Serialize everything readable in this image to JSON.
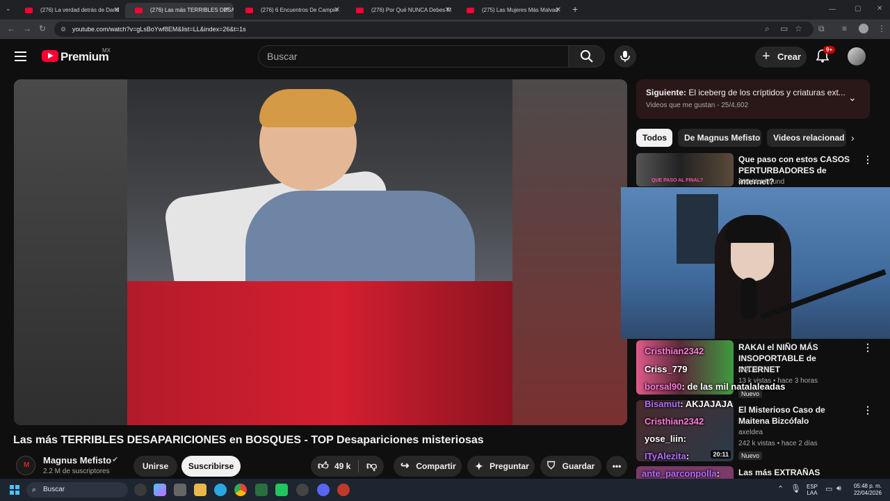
{
  "browser": {
    "tabs": [
      {
        "label": "(276) La verdad detrás de Dand"
      },
      {
        "label": "(276) Las más TERRIBLES DESAP"
      },
      {
        "label": "(276) 6 Encuentros De Campin"
      },
      {
        "label": "(276) Por Qué NUNCA Debes M"
      },
      {
        "label": "(275) Las Mujeres Más Malvad"
      }
    ],
    "new_tab": "+",
    "url": "youtube.com/watch?v=gLsBoYwf8EM&list=LL&index=26&t=1s"
  },
  "header": {
    "logo_text": "Premium",
    "logo_region": "MX",
    "search_placeholder": "Buscar",
    "create_label": "Crear",
    "notif_badge": "9+"
  },
  "video": {
    "title": "Las más TERRIBLES DESAPARICIONES en BOSQUES - TOP Desapariciones misteriosas",
    "channel": "Magnus Mefisto",
    "subscribers": "2.2 M de suscriptores",
    "join_label": "Unirse",
    "subscribe_label": "Suscribirse",
    "likes": "49 k",
    "share_label": "Compartir",
    "ask_label": "Preguntar",
    "save_label": "Guardar"
  },
  "queue": {
    "next_prefix": "Siguiente:",
    "next_title": "El iceberg de los críptidos y criaturas ext...",
    "playlist": "Videos que me gustan",
    "position": "25/4,602"
  },
  "chips": [
    "Todos",
    "De Magnus Mefisto",
    "Videos relacionad"
  ],
  "recommendations": [
    {
      "title": "Que paso con estos CASOS PERTURBADORES de internet?",
      "channel": "404 Not Found",
      "thumb_text": "QUE PASO AL FINAL?"
    },
    {
      "title": "RAKAI el NIÑO MÁS INSOPORTABLE de INTERNET",
      "channel": "AQUISI R",
      "meta": "13 k vistas • hace 3 horas",
      "badge": "Nuevo"
    },
    {
      "title": "El Misterioso Caso de Maitena Bizcófalo",
      "channel": "axeldea",
      "meta": "242 k vistas • hace 2 días",
      "badge": "Nuevo",
      "duration": "20:11"
    },
    {
      "title": "Las más EXTRAÑAS"
    }
  ],
  "overlay_chat": [
    {
      "user": "Cristhian2342",
      "msg": ""
    },
    {
      "user": "Criss_779",
      "msg": ""
    },
    {
      "user": "borsal90",
      "msg": ": de las mil natalaleadas"
    },
    {
      "user": "Bisamut",
      "msg": ": AKJAJAJA"
    },
    {
      "user": "Cristhian2342",
      "msg": ""
    },
    {
      "user": "yose_liin",
      "msg": ":"
    },
    {
      "user": "ITyAlezita",
      "msg": ":"
    },
    {
      "user": "ante_parconpolla",
      "msg": ":"
    }
  ],
  "taskbar": {
    "search_label": "Buscar",
    "lang_top": "ESP",
    "lang_bottom": "LAA",
    "time": "05:48 p. m.",
    "date": "22/04/2026"
  },
  "colors": {
    "youtube_red": "#ff0033",
    "chat_pink": "#ff7ad9",
    "chat_purple": "#b36bff"
  }
}
